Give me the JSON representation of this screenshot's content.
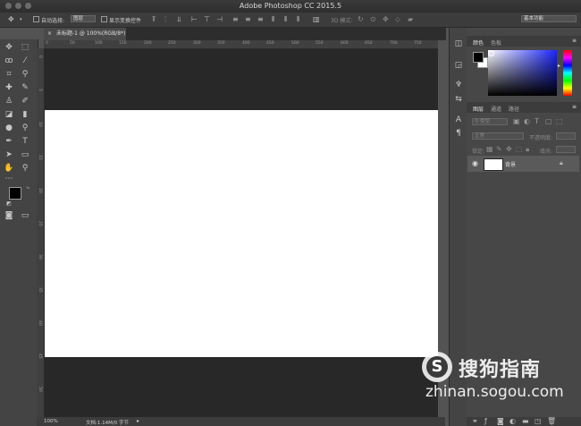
{
  "window": {
    "title": "Adobe Photoshop CC 2015.5"
  },
  "options_bar": {
    "auto_select_label": "自动选择:",
    "auto_select_value": "图层",
    "show_transform_label": "显示变换控件",
    "mode_3d_label": "3D 模式:",
    "workspace_value": "基本功能"
  },
  "document": {
    "tab_title": "未标题-1 @ 100%(RGB/8*)"
  },
  "ruler": {
    "top_ticks": [
      "0",
      "50",
      "100",
      "150",
      "200",
      "250",
      "300",
      "350",
      "400",
      "450",
      "500",
      "550",
      "600",
      "650",
      "700",
      "750"
    ],
    "left_ticks": [
      "0",
      "5",
      "10",
      "15",
      "20",
      "25",
      "30",
      "35",
      "40",
      "45",
      "50"
    ]
  },
  "status": {
    "zoom": "100%",
    "doc_info": "文档:1.14M/0 字节"
  },
  "panels": {
    "color_tabs": [
      "颜色",
      "色板"
    ],
    "layers_tabs": [
      "图层",
      "通道",
      "路径"
    ],
    "filter_kind": "类型",
    "blend_mode": "正常",
    "opacity_label": "不透明度:",
    "lock_label": "锁定:",
    "fill_label": "填充:",
    "layer_name": "背景"
  },
  "colors": {
    "foreground": "#000000",
    "background": "#ffffff",
    "canvas": "#ffffff",
    "pasteboard": "#282828"
  },
  "watermark": {
    "brand": "搜狗指南",
    "url": "zhinan.sogou.com"
  }
}
